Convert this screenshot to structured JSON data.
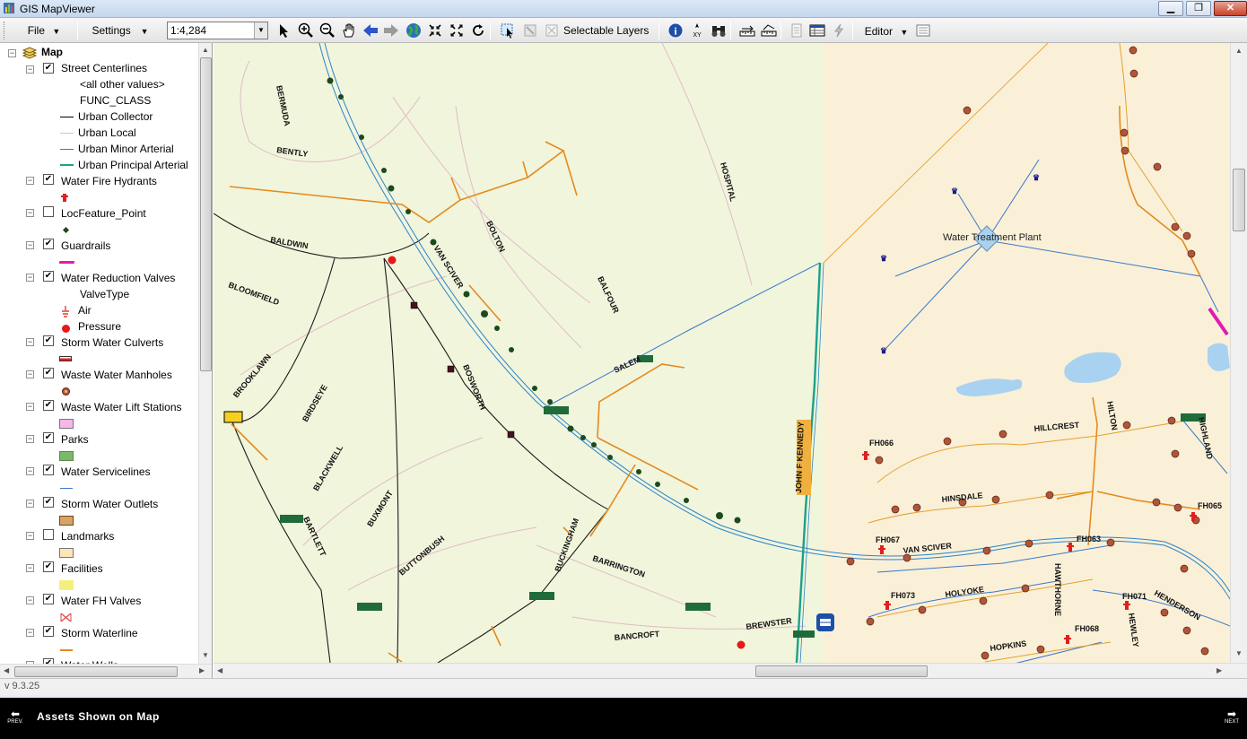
{
  "window": {
    "title": "GIS MapViewer"
  },
  "toolbar": {
    "file_label": "File",
    "settings_label": "Settings",
    "scale_value": "1:4,284",
    "selectable_layers_label": "Selectable Layers",
    "editor_label": "Editor"
  },
  "toc": {
    "root_label": "Map",
    "layers": [
      {
        "label": "Street Centerlines",
        "checked": true
      },
      {
        "label": "Water Fire Hydrants",
        "checked": true
      },
      {
        "label": "LocFeature_Point",
        "checked": false
      },
      {
        "label": "Guardrails",
        "checked": true
      },
      {
        "label": "Water Reduction Valves",
        "checked": true
      },
      {
        "label": "Storm Water Culverts",
        "checked": true
      },
      {
        "label": "Waste Water Manholes",
        "checked": true
      },
      {
        "label": "Waste Water Lift Stations",
        "checked": true
      },
      {
        "label": "Parks",
        "checked": true
      },
      {
        "label": "Water Servicelines",
        "checked": true
      },
      {
        "label": "Storm Water Outlets",
        "checked": true
      },
      {
        "label": "Landmarks",
        "checked": false
      },
      {
        "label": "Facilities",
        "checked": true
      },
      {
        "label": "Water FH Valves",
        "checked": true
      },
      {
        "label": "Storm Waterline",
        "checked": true
      },
      {
        "label": "Water Wells",
        "checked": true
      }
    ],
    "street_classes": {
      "other": "<all other values>",
      "heading": "FUNC_CLASS",
      "items": [
        "Urban Collector",
        "Urban Local",
        "Urban Minor Arterial",
        "Urban Principal Arterial"
      ]
    },
    "valve_types": {
      "heading": "ValveType",
      "items": [
        "Air",
        "Pressure"
      ]
    }
  },
  "colors": {
    "map_background": "#f1f5dc",
    "right_zone": "#faf0d8",
    "street_local": "#e0bcc6",
    "street_minor_arterial": "#2a83c8",
    "street_principal_arterial": "#1aa28a",
    "storm_waterline": "#e58a1c",
    "waterline": "#3a78c9",
    "manhole": "#b0553a",
    "hydrant": "#e02020",
    "pond": "#a9d2f0"
  },
  "map": {
    "streets": [
      "BERMUDA",
      "BENTLY",
      "BALDWIN",
      "BLOOMFIELD",
      "BOLTON",
      "BALFOUR",
      "HOSPITAL",
      "VAN SCIVER",
      "BROOKLAWN",
      "BIRDSEYE",
      "BOSWORTH",
      "BLACKWELL",
      "BUXMONT",
      "BARTLETT",
      "BUTTONBUSH",
      "BUCKINGHAM",
      "BARRINGTON",
      "BANCROFT",
      "BREWSTER",
      "SALEM",
      "JOHN F KENNEDY",
      "HILLCREST",
      "HILTON",
      "HIGHLAND",
      "HINSDALE",
      "HOLYOKE",
      "HOPKINS",
      "HAWTHORNE",
      "HENDERSON",
      "HEWLEY"
    ],
    "facility_label": "Water Treatment Plant",
    "hydrants": [
      "FH066",
      "FH067",
      "FH063",
      "FH065",
      "FH073",
      "FH071",
      "FH068"
    ]
  },
  "status": {
    "version": "v 9.3.25"
  },
  "caption": {
    "text": "Assets Shown on Map",
    "prev_label": "PREV.",
    "next_label": "NEXT"
  }
}
